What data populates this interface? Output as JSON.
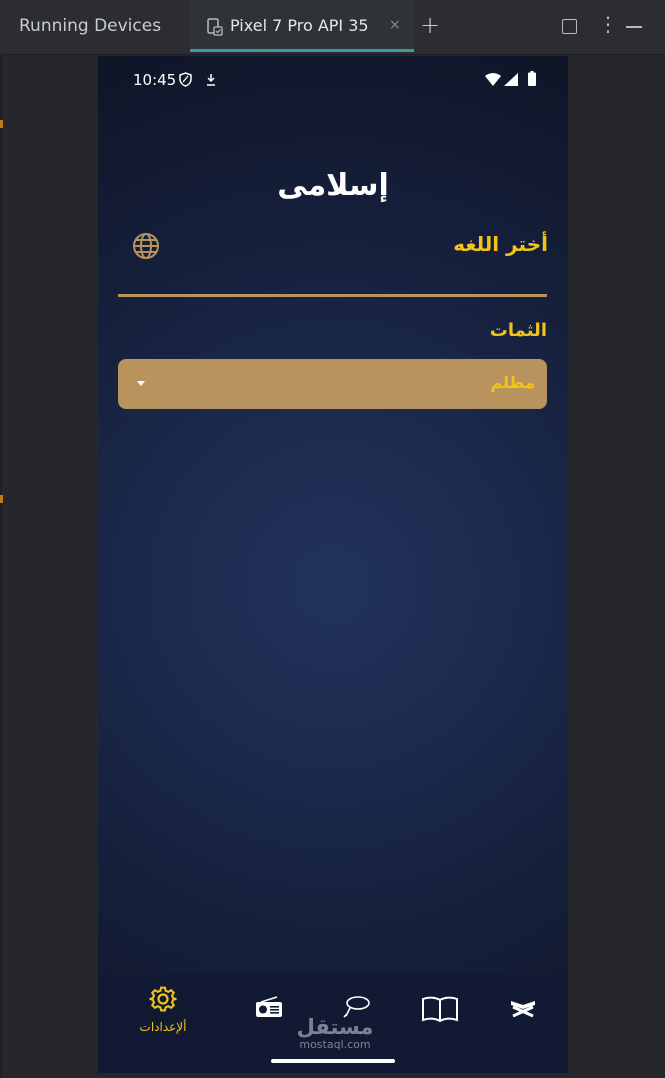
{
  "ide": {
    "tool_window_title": "Running Devices",
    "tabs": [
      {
        "label": "Pixel 7 Pro API 35",
        "close": "×"
      }
    ],
    "add_tab": "+",
    "more": "⋮"
  },
  "phone": {
    "status_bar": {
      "time": "10:45"
    },
    "app_title": "إسلامى",
    "settings": {
      "language_label": "أختر اللغه",
      "theme_label": "الثمات",
      "theme_selected": "مظلم"
    },
    "bottom_nav": {
      "items": [
        {
          "icon": "gear-icon",
          "label": "ألإعدادات",
          "active": true
        },
        {
          "icon": "radio-icon",
          "label": ""
        },
        {
          "icon": "tasbeeh-icon",
          "label": ""
        },
        {
          "icon": "open-book-icon",
          "label": ""
        },
        {
          "icon": "quran-icon",
          "label": ""
        }
      ]
    },
    "watermark": {
      "arabic": "مستقل",
      "latin": "mostaql.com"
    }
  },
  "colors": {
    "gold_text": "#f0c419",
    "tan_accent": "#b8935e",
    "ide_tab_underline": "#3e9aa5",
    "nav_background": "#121a33"
  }
}
